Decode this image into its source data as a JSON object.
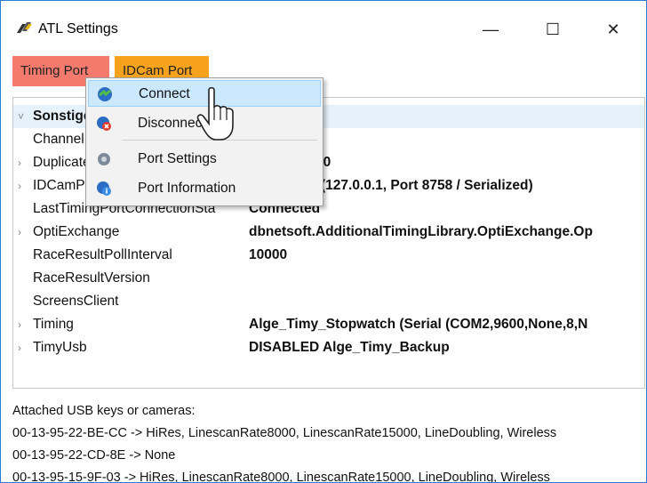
{
  "window": {
    "title": "ATL Settings",
    "minimize": "—",
    "maximize": "☐",
    "close": "✕"
  },
  "tabs": [
    {
      "label": "Timing Port",
      "color": "#f47a6e"
    },
    {
      "label": "IDCam Port",
      "color": "#f7a21c"
    }
  ],
  "grid": {
    "rows": [
      {
        "name": "Sonstige",
        "value": "",
        "expander": "˅",
        "category": true
      },
      {
        "name": "ChannelName",
        "value": "",
        "expander": ""
      },
      {
        "name": "DuplicateCount",
        "value": "00",
        "expander": "›"
      },
      {
        "name": "IDCamPort",
        "value": "(127.0.0.1, Port 8758 / Serialized)",
        "expander": "›"
      },
      {
        "name": "LastTimingPortConnectionSta",
        "value": "Connected",
        "expander": ""
      },
      {
        "name": "OptiExchange",
        "value": "dbnetsoft.AdditionalTimingLibrary.OptiExchange.Op",
        "expander": "›"
      },
      {
        "name": "RaceResultPollInterval",
        "value": "10000",
        "expander": ""
      },
      {
        "name": "RaceResultVersion",
        "value": "",
        "expander": ""
      },
      {
        "name": "ScreensClient",
        "value": "",
        "expander": ""
      },
      {
        "name": "Timing",
        "value": "Alge_Timy_Stopwatch (Serial (COM2,9600,None,8,N",
        "expander": "›"
      },
      {
        "name": "TimyUsb",
        "value": "DISABLED Alge_Timy_Backup",
        "expander": "›"
      }
    ]
  },
  "usb": {
    "header": "Attached USB keys or cameras:",
    "lines": [
      "00-13-95-22-BE-CC -> HiRes, LinescanRate8000, LinescanRate15000, LineDoubling, Wireless",
      "00-13-95-22-CD-8E -> None",
      "00-13-95-15-9F-03 -> HiRes, LinescanRate8000, LinescanRate15000, LineDoubling, Wireless"
    ]
  },
  "context_menu": {
    "items": [
      {
        "label": "Connect",
        "icon": "connect-icon"
      },
      {
        "label": "Disconnect",
        "icon": "disconnect-icon"
      },
      {
        "label": "Port Settings",
        "icon": "port-settings-icon"
      },
      {
        "label": "Port Information",
        "icon": "port-information-icon"
      }
    ]
  }
}
